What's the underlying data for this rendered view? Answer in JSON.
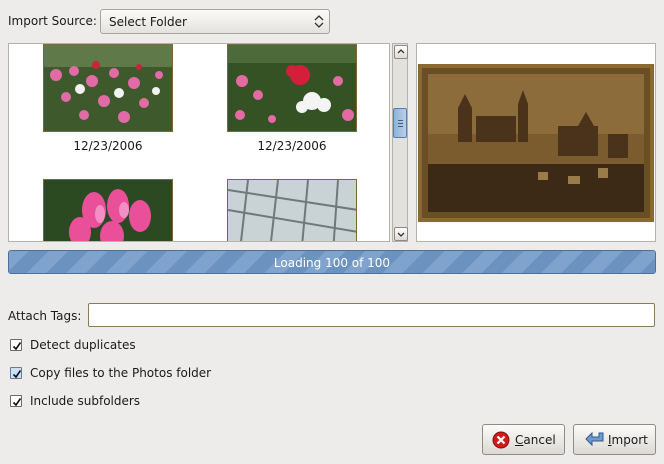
{
  "import_source": {
    "label": "Import Source:",
    "value": "Select Folder"
  },
  "thumbnails": [
    {
      "date": "12/23/2006",
      "icon": "photo-thumbnail-flowers-1"
    },
    {
      "date": "12/23/2006",
      "icon": "photo-thumbnail-flowers-2"
    },
    {
      "date": "",
      "icon": "photo-thumbnail-cyclamen"
    },
    {
      "date": "",
      "icon": "photo-thumbnail-greenhouse"
    }
  ],
  "progress": {
    "text": "Loading 100 of 100",
    "fraction": 1.0
  },
  "tags": {
    "label": "Attach Tags:",
    "value": ""
  },
  "options": [
    {
      "label": "Detect duplicates",
      "checked": true
    },
    {
      "label": "Copy files to the Photos folder",
      "checked": true
    },
    {
      "label": "Include subfolders",
      "checked": true
    }
  ],
  "buttons": {
    "cancel": {
      "mnemonic": "C",
      "rest": "ancel"
    },
    "import": {
      "mnemonic": "I",
      "rest": "mport"
    }
  },
  "colors": {
    "accent": "#7fa3cd",
    "progress_border": "#4e6f96",
    "window_bg": "#edeceb"
  }
}
